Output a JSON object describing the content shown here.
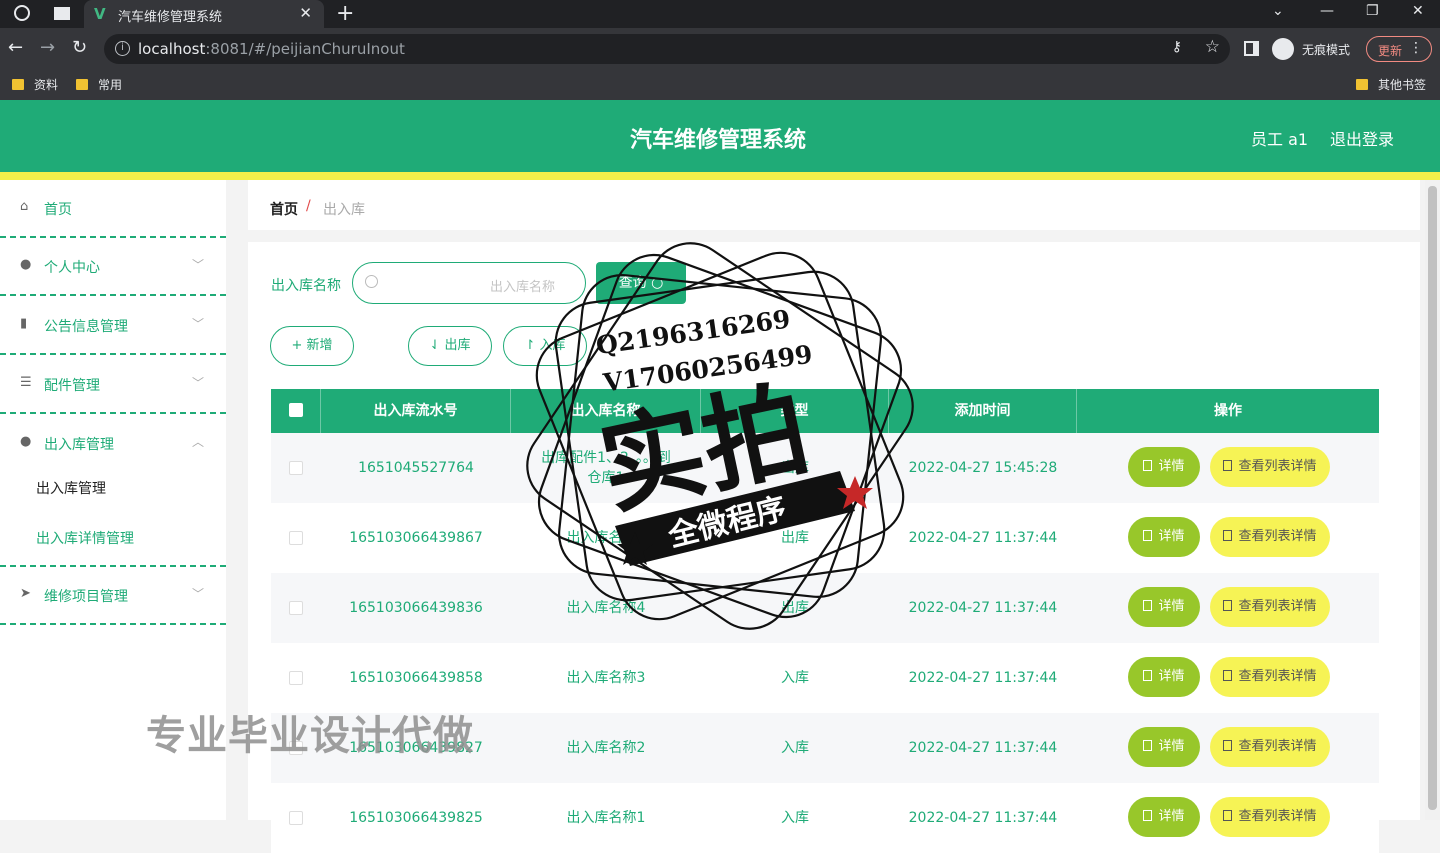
{
  "browser": {
    "tab_title": "汽车维修管理系统",
    "url_host": "localhost",
    "url_rest": ":8081/#/peijianChuruInout",
    "incognito_label": "无痕模式",
    "update_label": "更新",
    "bookmarks": [
      "资料",
      "常用"
    ],
    "other_bookmarks": "其他书签"
  },
  "header": {
    "title": "汽车维修管理系统",
    "user": "员工 a1",
    "logout": "退出登录"
  },
  "sidebar": {
    "items": [
      {
        "label": "首页",
        "icon": "home-icon"
      },
      {
        "label": "个人中心",
        "icon": "user-icon"
      },
      {
        "label": "公告信息管理",
        "icon": "bar-chart-icon"
      },
      {
        "label": "配件管理",
        "icon": "sliders-icon"
      },
      {
        "label": "出入库管理",
        "icon": "bulb-icon"
      },
      {
        "label": "维修项目管理",
        "icon": "send-icon"
      }
    ],
    "sub_items": [
      "出入库管理",
      "出入库详情管理"
    ]
  },
  "breadcrumb": {
    "home": "首页",
    "separator": "/",
    "current": "出入库"
  },
  "search": {
    "label": "出入库名称",
    "placeholder": "出入库名称",
    "button": "查询"
  },
  "actions": {
    "add": "新增",
    "out": "出库",
    "in": "入库"
  },
  "table": {
    "headers": [
      "出入库流水号",
      "出入库名称",
      "类型",
      "添加时间",
      "操作"
    ],
    "rows": [
      {
        "no": "1651045527764",
        "name": "出库配件1、2。。。到仓库1",
        "type": "出库",
        "time": "2022-04-27 15:45:28"
      },
      {
        "no": "165103066439867",
        "name": "出入库名称5",
        "type": "出库",
        "time": "2022-04-27 11:37:44"
      },
      {
        "no": "165103066439836",
        "name": "出入库名称4",
        "type": "出库",
        "time": "2022-04-27 11:37:44"
      },
      {
        "no": "165103066439858",
        "name": "出入库名称3",
        "type": "入库",
        "time": "2022-04-27 11:37:44"
      },
      {
        "no": "165103066439827",
        "name": "出入库名称2",
        "type": "入库",
        "time": "2022-04-27 11:37:44"
      },
      {
        "no": "165103066439825",
        "name": "出入库名称1",
        "type": "入库",
        "time": "2022-04-27 11:37:44"
      }
    ],
    "detail_label": "详情",
    "list_label": "查看列表详情"
  },
  "watermark": {
    "contact1": "Q2196316269",
    "contact2": "V17060256499",
    "big": "实拍",
    "ribbon": "全微程序",
    "bottom_ad": "专业毕业设计代做"
  },
  "colors": {
    "primary": "#1fab77",
    "accent_yellow": "#f3f04a",
    "detail_button": "#98c72a",
    "list_button": "#f6f355"
  }
}
